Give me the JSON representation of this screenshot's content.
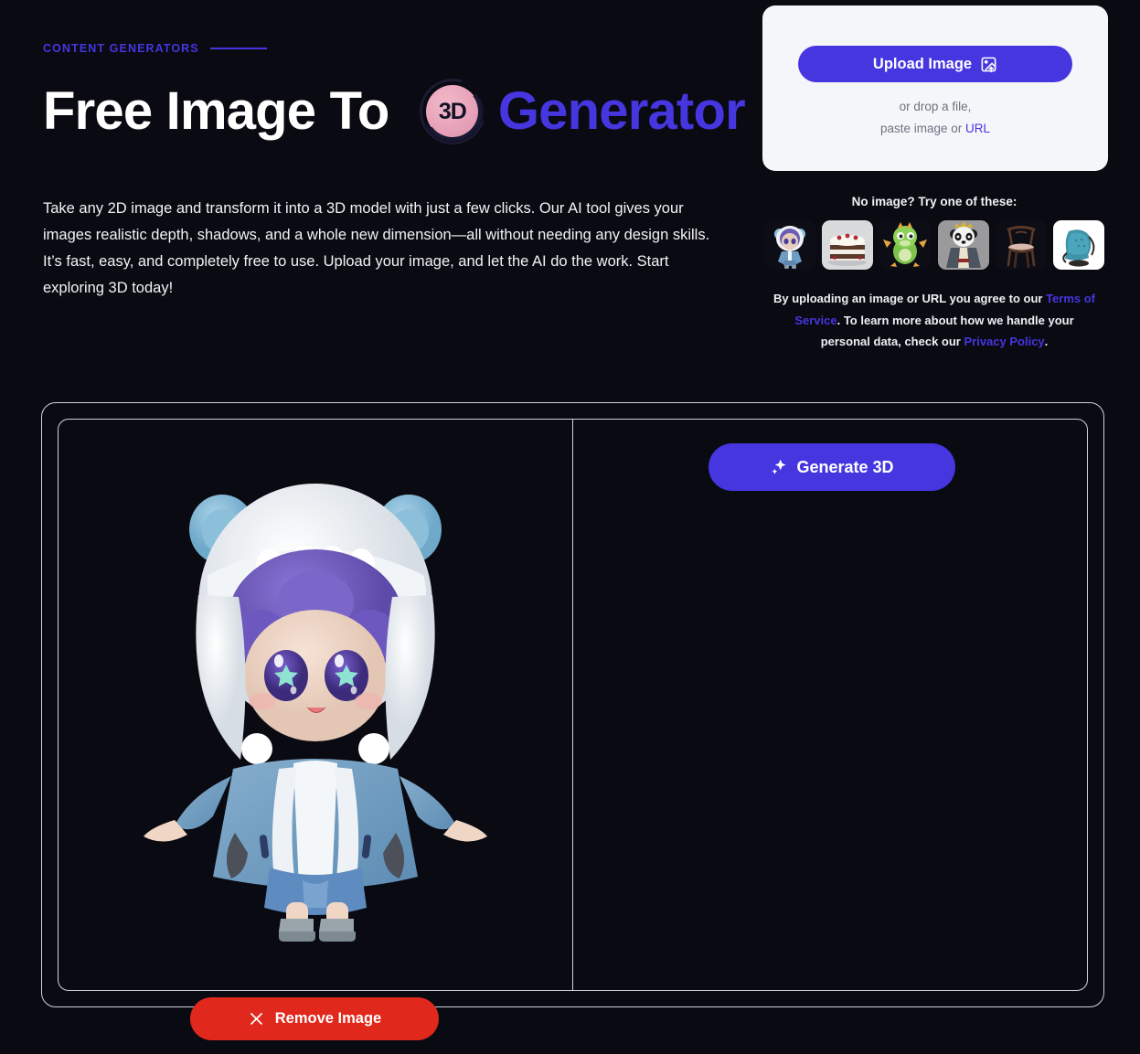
{
  "hero": {
    "eyebrow": "CONTENT GENERATORS",
    "title_part1": "Free Image To ",
    "logo_text": "3D",
    "title_accent": "Generator",
    "description": "Take any 2D image and transform it into a 3D model with just a few clicks. Our AI tool gives your images realistic depth, shadows, and a whole new dimension—all without needing any design skills. It’s fast, easy, and completely free to use. Upload your image, and let the AI do the work. Start exploring 3D today!"
  },
  "upload": {
    "button_label": "Upload Image",
    "button_icon": "image-upload-icon",
    "drop_text": "or drop a file,",
    "paste_prefix": "paste image or ",
    "url_link": "URL"
  },
  "samples": {
    "label": "No image? Try one of these:",
    "items": [
      {
        "name": "chibi-hooded-character",
        "alt": "Chibi character in blue bear hoodie"
      },
      {
        "name": "layer-cake",
        "alt": "Chocolate berry layer cake"
      },
      {
        "name": "green-dragon",
        "alt": "Cartoon green dragon"
      },
      {
        "name": "panda-king",
        "alt": "Panda wearing a crown and robe"
      },
      {
        "name": "wooden-chair",
        "alt": "Wooden dining chair"
      },
      {
        "name": "teal-armchair",
        "alt": "Teal tufted swivel armchair"
      }
    ]
  },
  "legal": {
    "prefix": "By uploading an image or URL you agree to our ",
    "terms_link": "Terms of Service",
    "middle": ". To learn more about how we handle your personal data, check our ",
    "privacy_link": "Privacy Policy",
    "suffix": "."
  },
  "workspace": {
    "generate_label": "Generate 3D",
    "generate_icon": "sparkle-icon",
    "remove_label": "Remove Image",
    "remove_icon": "close-x-icon",
    "preview_alt": "Chibi character in blue bear hoodie with purple hair and star eyes"
  },
  "colors": {
    "background": "#0a0a12",
    "accent": "#4536e0",
    "card": "#f5f6fa",
    "danger": "#e0281c",
    "border": "#cfd2de",
    "logo_disc": "#e6a0b8"
  }
}
